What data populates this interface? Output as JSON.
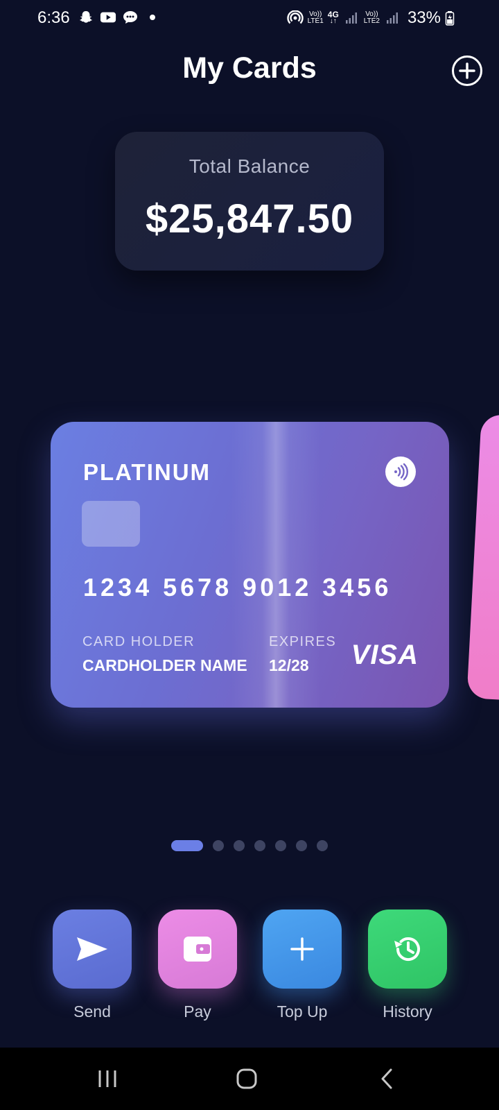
{
  "status_bar": {
    "time": "6:36",
    "left_icons": [
      "snapchat-icon",
      "youtube-icon",
      "message-icon",
      "dot-icon"
    ],
    "sim1_top": "Vo))",
    "sim1_bottom": "LTE1",
    "network_type": "4G",
    "sim2_top": "Vo))",
    "sim2_bottom": "LTE2",
    "battery": "33%"
  },
  "header": {
    "title": "My Cards",
    "add_icon": "plus-circle-icon"
  },
  "balance": {
    "label": "Total Balance",
    "amount": "$25,847.50"
  },
  "card": {
    "tier": "PLATINUM",
    "number": "1234 5678 9012 3456",
    "holder_label": "CARD HOLDER",
    "holder_name": "CARDHOLDER NAME",
    "expires_label": "EXPIRES",
    "expires_value": "12/28",
    "network": "VISA",
    "gradient_start": "#6b7fe2",
    "gradient_end": "#7a54b0"
  },
  "pager": {
    "total": 7,
    "active_index": 0
  },
  "actions": [
    {
      "label": "Send",
      "icon": "send-icon",
      "color": "#6b7fe2"
    },
    {
      "label": "Pay",
      "icon": "wallet-icon",
      "color": "#ec8ce6"
    },
    {
      "label": "Top Up",
      "icon": "plus-icon",
      "color": "#4fa5f2"
    },
    {
      "label": "History",
      "icon": "history-icon",
      "color": "#3ed97a"
    }
  ],
  "nav": {
    "recents": "recent-apps-icon",
    "home": "home-icon",
    "back": "back-icon"
  }
}
